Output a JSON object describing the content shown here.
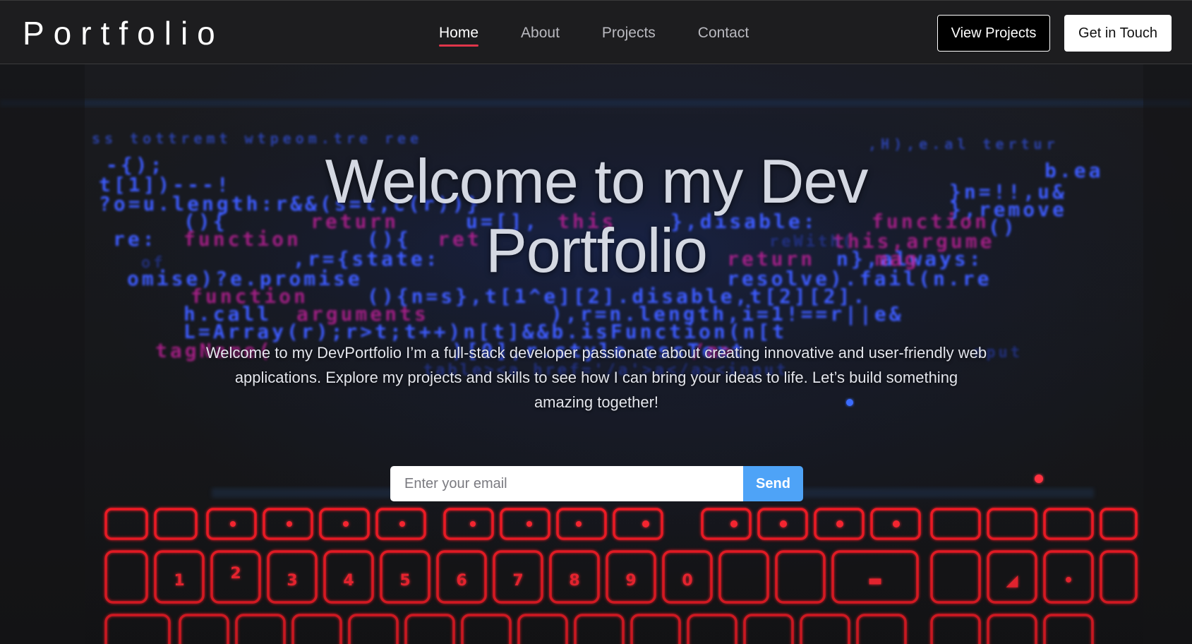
{
  "navbar": {
    "brand": "Portfolio",
    "links": [
      "Home",
      "About",
      "Projects",
      "Contact"
    ],
    "active_link": "Home",
    "view_projects_label": "View Projects",
    "get_in_touch_label": "Get in Touch"
  },
  "hero": {
    "title": "Welcome to my Dev Portfolio",
    "description": "Welcome to my DevPortfolio I’m a full-stack developer passionate about creating innovative and user-friendly web applications. Explore my projects and skills to see how I can bring your ideas to life. Let’s build something amazing together!",
    "email_placeholder": "Enter your email",
    "send_label": "Send"
  },
  "colors": {
    "accent_underline": "#e0364a",
    "send_button": "#4ea3f7",
    "keyboard_glow": "#ff1e28",
    "code_blue": "#3a5cff",
    "code_magenta": "#d02aa0"
  },
  "icons": {
    "background": "code-and-keyboard-photo"
  }
}
